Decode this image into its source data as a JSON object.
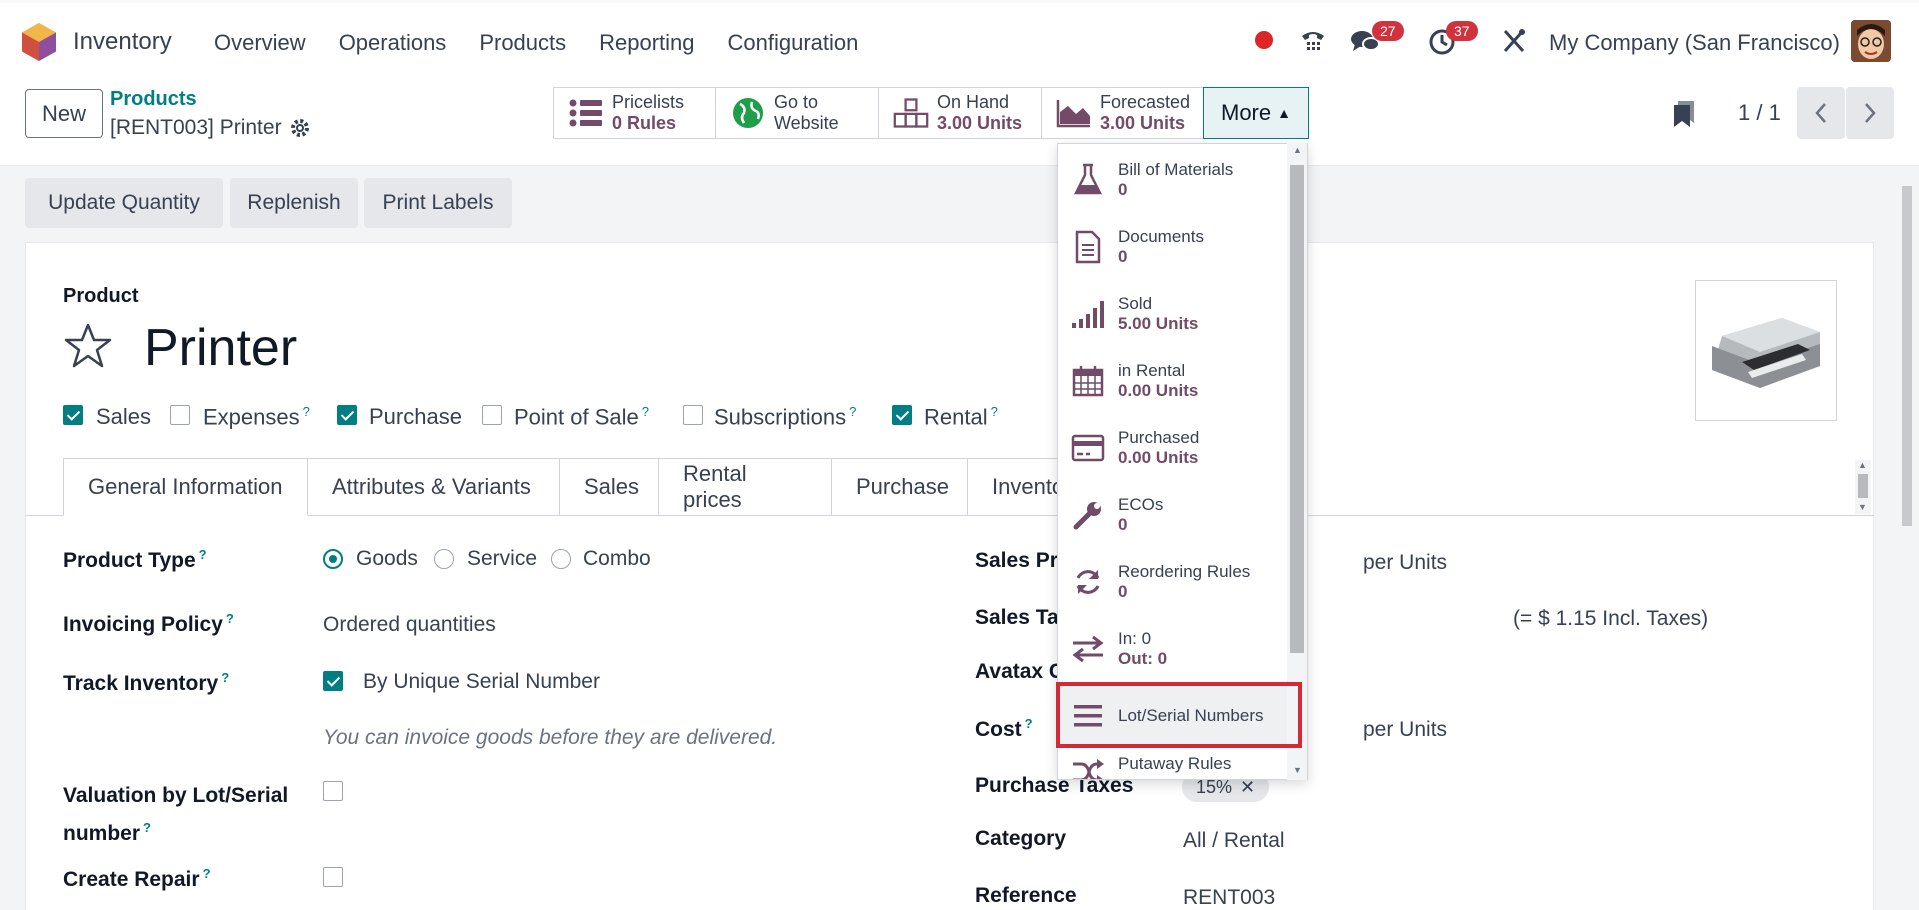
{
  "nav": {
    "app_title": "Inventory",
    "menu": [
      "Overview",
      "Operations",
      "Products",
      "Reporting",
      "Configuration"
    ],
    "chat_badge": "27",
    "activity_badge": "37",
    "company": "My Company (San Francisco)"
  },
  "control": {
    "new_label": "New",
    "breadcrumb_parent": "Products",
    "breadcrumb_current": "[RENT003] Printer",
    "smart_buttons": [
      {
        "line1": "Pricelists",
        "line2": "0  Rules"
      },
      {
        "line1": "Go to",
        "line2": "Website"
      },
      {
        "line1": "On Hand",
        "line2": "3.00 Units"
      },
      {
        "line1": "Forecasted",
        "line2": "3.00 Units"
      }
    ],
    "more_label": "More",
    "pager": "1 / 1"
  },
  "actions": [
    "Update Quantity",
    "Replenish",
    "Print Labels"
  ],
  "product": {
    "label": "Product",
    "name": "Printer",
    "checkboxes": [
      {
        "label": "Sales",
        "checked": true,
        "help": false
      },
      {
        "label": "Expenses",
        "checked": false,
        "help": true
      },
      {
        "label": "Purchase",
        "checked": true,
        "help": false
      },
      {
        "label": "Point of Sale",
        "checked": false,
        "help": true
      },
      {
        "label": "Subscriptions",
        "checked": false,
        "help": true
      },
      {
        "label": "Rental",
        "checked": true,
        "help": true
      }
    ]
  },
  "tabs": [
    "General Information",
    "Attributes & Variants",
    "Sales",
    "Rental prices",
    "Purchase",
    "Invento"
  ],
  "left_fields": {
    "product_type_label": "Product Type",
    "product_type_options": [
      "Goods",
      "Service",
      "Combo"
    ],
    "invoicing_label": "Invoicing Policy",
    "invoicing_value": "Ordered quantities",
    "track_label": "Track Inventory",
    "track_value": "By Unique Serial Number",
    "invoice_note": "You can invoice goods before they are delivered.",
    "valuation_label_1": "Valuation by Lot/Serial",
    "valuation_label_2": "number",
    "repair_label": "Create Repair"
  },
  "right_fields": {
    "sales_price_label": "Sales Pri",
    "sales_price_unit": "per Units",
    "sales_taxes_label": "Sales Tax",
    "sales_taxes_incl": "(= $ 1.15 Incl. Taxes)",
    "avatax_label": "Avatax C",
    "cost_label": "Cost",
    "cost_unit": "per Units",
    "purchase_taxes_label": "Purchase Taxes",
    "purchase_taxes_tag": "15%",
    "category_label": "Category",
    "category_value": "All / Rental",
    "reference_label": "Reference",
    "reference_value": "RENT003"
  },
  "dropdown": [
    {
      "line1": "Bill of Materials",
      "line2": "0",
      "icon": "flask-icon"
    },
    {
      "line1": "Documents",
      "line2": "0",
      "icon": "document-icon"
    },
    {
      "line1": "Sold",
      "line2": "5.00 Units",
      "icon": "signal-icon"
    },
    {
      "line1": "in Rental",
      "line2": "0.00 Units",
      "icon": "calendar-icon"
    },
    {
      "line1": "Purchased",
      "line2": "0.00 Units",
      "icon": "credit-card-icon"
    },
    {
      "line1": "ECOs",
      "line2": "0",
      "icon": "wrench-icon"
    },
    {
      "line1": "Reordering Rules",
      "line2": "0",
      "icon": "refresh-icon"
    },
    {
      "line1": "In: 0",
      "line2": "Out: 0",
      "icon": "exchange-icon"
    },
    {
      "line1": "Lot/Serial Numbers",
      "line2": "",
      "icon": "bars-icon"
    },
    {
      "line1": "Putaway Rules",
      "line2": "",
      "icon": "random-icon"
    }
  ],
  "colors": {
    "accent": "#017e84",
    "brand": "#714b67",
    "highlight": "#d42a35"
  }
}
